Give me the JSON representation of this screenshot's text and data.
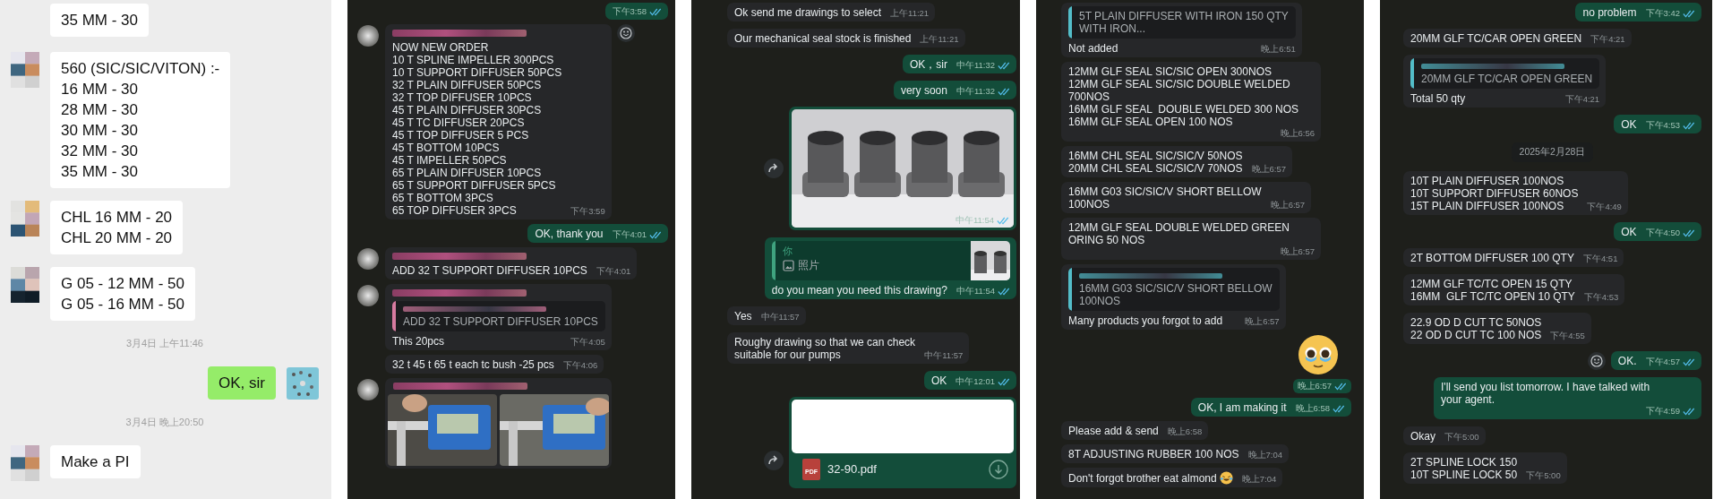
{
  "panels": [
    {
      "messages": [
        {
          "kind": "in",
          "avatar": false,
          "text": "35 MM - 30"
        },
        {
          "kind": "in",
          "avatar": true,
          "text": "560 (SIC/SIC/VITON) :-\n16 MM - 30\n28 MM - 30\n30 MM - 30\n32 MM - 30\n35 MM - 30"
        },
        {
          "kind": "in",
          "avatar": true,
          "text": "CHL 16 MM - 20\nCHL 20 MM - 20"
        },
        {
          "kind": "in",
          "avatar": true,
          "text": "G 05 - 12 MM - 50\nG 05 - 16 MM - 50"
        },
        {
          "kind": "time",
          "text": "3月4日 上午11:46"
        },
        {
          "kind": "out",
          "avatar": true,
          "text": "OK, sir"
        },
        {
          "kind": "time",
          "text": "3月4日 晚上20:50"
        },
        {
          "kind": "in",
          "avatar": true,
          "text": "Make a PI"
        }
      ]
    },
    {
      "messages": [
        {
          "kind": "out",
          "time": "下午3:58",
          "read": true
        },
        {
          "kind": "in",
          "avatar": true,
          "sender_blurred": true,
          "reaction": true,
          "text": "NOW NEW ORDER\n10 T SPLINE IMPELLER 300PCS\n10 T SUPPORT DIFFUSER 50PCS\n32 T PLAIN DIFFUSER 50PCS\n32 T TOP DIFFUSER 10PCS\n45 T PLAIN DIFFUSER 30PCS\n45 T TC DIFFUSER 20PCS\n45 T TOP DIFFUSER 5 PCS\n45 T BOTTOM 10PCS\n45 T IMPELLER 50PCS\n65 T PLAIN DIFFUSER 10PCS\n65 T SUPPORT DIFFUSER 5PCS\n65 T BOTTOM 3PCS\n65 TOP DIFFUSER 3PCS",
          "time": "下午3:59"
        },
        {
          "kind": "out",
          "text": "OK, thank you",
          "time": "下午4:01",
          "read": true
        },
        {
          "kind": "in",
          "avatar": true,
          "sender_blurred": true,
          "text": "ADD 32 T SUPPORT DIFFUSER 10PCS",
          "time": "下午4:01"
        },
        {
          "kind": "in",
          "avatar": true,
          "sender_blurred": true,
          "quote": {
            "author_blurred": true,
            "color": "#d77ba0",
            "text": "ADD 32 T SUPPORT DIFFUSER 10PCS"
          },
          "text": "This 20pcs",
          "time": "下午4:05"
        },
        {
          "kind": "in",
          "avatar": false,
          "text": "32 t 45 t 65 t each tc bush -25 pcs",
          "time": "下午4:06"
        },
        {
          "kind": "photos",
          "avatar": true,
          "sender_blurred": true
        }
      ]
    },
    {
      "messages": [
        {
          "kind": "in",
          "text": "Ok send me drawings to select",
          "time": "上午11:21"
        },
        {
          "kind": "in",
          "text": "Our mechanical seal stock is finished",
          "time": "上午11:21"
        },
        {
          "kind": "out",
          "text": "OK，sir",
          "time": "中午11:32",
          "read": true
        },
        {
          "kind": "out",
          "text": "very soon",
          "time": "中午11:32",
          "read": true
        },
        {
          "forward": true,
          "time": "中午11:54",
          "read": true
        },
        {
          "kind": "out",
          "quote": {
            "author": "你",
            "color": "#3fa37f",
            "text": "照片"
          },
          "text": "do you mean you need this drawing?",
          "time": "中午11:54",
          "read": true
        },
        {
          "kind": "in",
          "text": "Yes",
          "time": "中午11:57"
        },
        {
          "kind": "in",
          "text": "Roughy drawing so that we can check\nsuitable for our pumps",
          "time": "中午11:57"
        },
        {
          "kind": "out",
          "text": "OK",
          "time": "中午12:01",
          "read": true
        },
        {
          "kind": "document",
          "forward": true,
          "file_type": "PDF",
          "file": "32-90.pdf"
        }
      ]
    },
    {
      "messages": [
        {
          "kind": "in",
          "quote": {
            "color": "#53bdc9",
            "text": "5T PLAIN DIFFUSER WITH IRON 150 QTY\nWITH IRON..."
          },
          "text": "Not added",
          "time": "晚上6:51"
        },
        {
          "kind": "in",
          "text": "12MM GLF SEAL SIC/SIC OPEN 300NOS\n12MM GLF SEAL SIC/SIC DOUBLE WELDED\n700NOS\n16MM GLF SEAL  DOUBLE WELDED 300 NOS\n16MM GLF SEAL OPEN 100 NOS",
          "time": "晚上6:56"
        },
        {
          "kind": "in",
          "text": "16MM CHL SEAL SIC/SIC/V 50NOS\n20MM CHL SEAL SIC/SIC/V 70NOS",
          "time": "晚上6:57"
        },
        {
          "kind": "in",
          "text": "16MM G03 SIC/SIC/V SHORT BELLOW\n100NOS",
          "time": "晚上6:57"
        },
        {
          "kind": "in",
          "text": "12MM GLF SEAL DOUBLE WELDED GREEN\nORING 50 NOS",
          "time": "晚上6:57"
        },
        {
          "kind": "in",
          "quote": {
            "author_blurred": true,
            "color": "#53bdc9",
            "text": "16MM G03 SIC/SIC/V SHORT BELLOW\n100NOS"
          },
          "text": "Many products you forgot to add",
          "time": "晚上6:57"
        },
        {
          "kind": "sticker",
          "time": "晚上6:57",
          "read": true
        },
        {
          "kind": "out",
          "text": "OK, I am making it",
          "time": "晚上6:58",
          "read": true
        },
        {
          "kind": "in",
          "text": "Please add & send",
          "time": "晚上6:58"
        },
        {
          "kind": "in",
          "text": "8T ADJUSTING RUBBER 100 NOS",
          "time": "晚上7:04"
        },
        {
          "kind": "in",
          "text": "Don't forgot brother eat almond",
          "emoji": true,
          "time": "晚上7:04"
        }
      ]
    },
    {
      "messages": [
        {
          "kind": "out",
          "text": "no problem",
          "time": "下午3:42",
          "read": true
        },
        {
          "kind": "in",
          "text": "20MM GLF TC/CAR OPEN GREEN",
          "time": "下午4:21"
        },
        {
          "kind": "in",
          "quote": {
            "author_blurred": true,
            "color": "#53bdc9",
            "text": "20MM GLF TC/CAR OPEN GREEN"
          },
          "text": "Total 50 qty",
          "time": "下午4:21"
        },
        {
          "kind": "out",
          "text": "OK",
          "time": "下午4:53",
          "read": true
        },
        {
          "kind": "date",
          "text": "2025年2月28日"
        },
        {
          "kind": "in",
          "text": "10T PLAIN DIFFUSER 100NOS\n10T SUPPORT DIFFUSER 60NOS\n15T PLAIN DIFFUSER 100NOS",
          "time": "下午4:49"
        },
        {
          "kind": "out",
          "text": "OK",
          "time": "下午4:50",
          "read": true
        },
        {
          "kind": "in",
          "text": "2T BOTTOM DIFFUSER 100 QTY",
          "time": "下午4:51"
        },
        {
          "kind": "in",
          "text": "12MM GLF TC/TC OPEN 15 QTY\n16MM  GLF TC/TC OPEN 10 QTY",
          "time": "下午4:53"
        },
        {
          "kind": "in",
          "text": "22.9 OD D CUT TC 50NOS\n22 OD D CUT TC 100 NOS",
          "time": "下午4:55"
        },
        {
          "kind": "out",
          "reaction": true,
          "text": "OK.",
          "time": "下午4:57",
          "read": true
        },
        {
          "kind": "out",
          "text": "I'll send you list tomorrow. I have talked with\nyour agent.",
          "time": "下午4:59",
          "read": true
        },
        {
          "kind": "in",
          "text": "Okay",
          "time": "下午5:00"
        },
        {
          "kind": "in",
          "text": "2T SPLINE LOCK 150\n10T SPLINE LOCK 50",
          "time": "下午5:00"
        }
      ]
    }
  ]
}
